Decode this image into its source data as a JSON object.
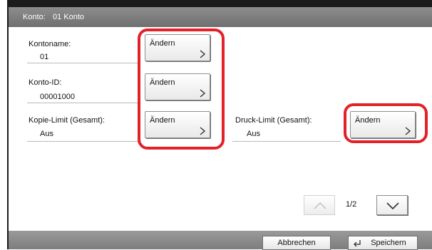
{
  "window": {
    "title_label": "Konto:",
    "title_value": "01 Konto"
  },
  "fields": [
    {
      "label": "Kontoname:",
      "value": "01",
      "button": "Ändern"
    },
    {
      "label": "Konto-ID:",
      "value": "00001000",
      "button": "Ändern"
    },
    {
      "label": "Kopie-Limit (Gesamt):",
      "value": "Aus",
      "button": "Ändern"
    },
    {
      "label": "Druck-Limit (Gesamt):",
      "value": "Aus",
      "button": "Ändern"
    }
  ],
  "pagination": {
    "indicator": "1/2",
    "up_icon": "chevron-up-icon",
    "down_icon": "chevron-down-icon"
  },
  "footer": {
    "cancel_label": "Abbrechen",
    "save_label": "Speichern",
    "save_icon": "enter-arrow-icon"
  },
  "colors": {
    "highlight_ring": "#e32129",
    "title_bar": "#7e7e7e",
    "footer_bar": "#8a8a8a"
  }
}
